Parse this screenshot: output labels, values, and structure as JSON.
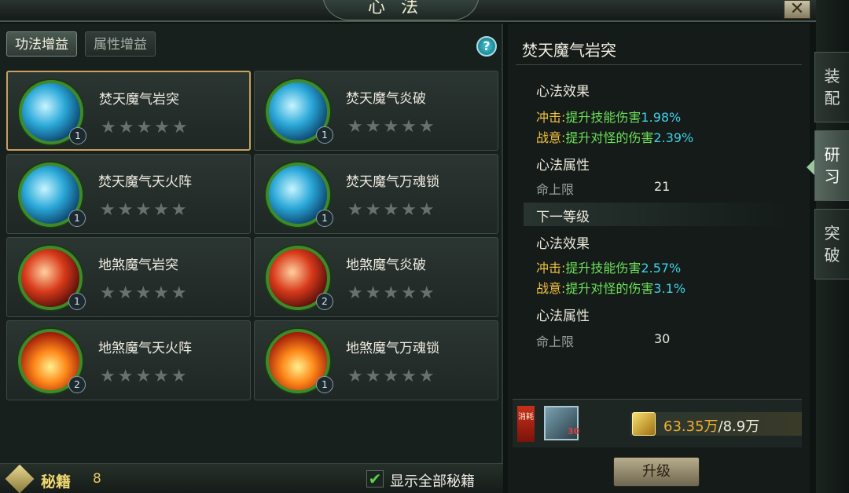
{
  "window": {
    "title": "心法",
    "close_label": "✕"
  },
  "tabs": {
    "active": "功法增益",
    "inactive": "属性增益",
    "help": "?"
  },
  "cards": [
    {
      "name": "焚天魔气岩突",
      "level": "1",
      "stars": "★★★★★",
      "style": "blue",
      "selected": true
    },
    {
      "name": "焚天魔气炎破",
      "level": "1",
      "stars": "★★★★★",
      "style": "blue"
    },
    {
      "name": "焚天魔气天火阵",
      "level": "1",
      "stars": "★★★★★",
      "style": "blue"
    },
    {
      "name": "焚天魔气万魂锁",
      "level": "1",
      "stars": "★★★★★",
      "style": "blue"
    },
    {
      "name": "地煞魔气岩突",
      "level": "1",
      "stars": "★★★★★",
      "style": "red"
    },
    {
      "name": "地煞魔气炎破",
      "level": "2",
      "stars": "★★★★★",
      "style": "red"
    },
    {
      "name": "地煞魔气天火阵",
      "level": "2",
      "stars": "★★★★★",
      "style": "fire"
    },
    {
      "name": "地煞魔气万魂锁",
      "level": "1",
      "stars": "★★★★★",
      "style": "fire"
    }
  ],
  "bottom": {
    "label": "秘籍",
    "count": "8",
    "check_mark": "✔",
    "show_all": "显示全部秘籍"
  },
  "detail": {
    "title": "焚天魔气岩突",
    "current": {
      "effect_heading": "心法效果",
      "effects": [
        {
          "key": "冲击:",
          "text": "提升技能伤害",
          "value": "1.98%"
        },
        {
          "key": "战意:",
          "text": "提升对怪的伤害",
          "value": "2.39%"
        }
      ],
      "attr_heading": "心法属性",
      "attr_name": "命上限",
      "attr_value": "21"
    },
    "next_label": "下一等级",
    "next": {
      "effect_heading": "心法效果",
      "effects": [
        {
          "key": "冲击:",
          "text": "提升技能伤害",
          "value": "2.57%"
        },
        {
          "key": "战意:",
          "text": "提升对怪的伤害",
          "value": "3.1%"
        }
      ],
      "attr_heading": "心法属性",
      "attr_name": "命上限",
      "attr_value": "30"
    },
    "cost": {
      "tag": "消耗",
      "book_count": "30",
      "money_have": "63.35万",
      "money_need": "/8.9万"
    },
    "upgrade_label": "升级"
  },
  "side_tabs": [
    "装配",
    "研习",
    "突破"
  ],
  "colors": {
    "effect_key": "#f0c040",
    "effect_text": "#6ee05a",
    "effect_value": "#40d0e8",
    "selected_border": "#c8a060"
  }
}
